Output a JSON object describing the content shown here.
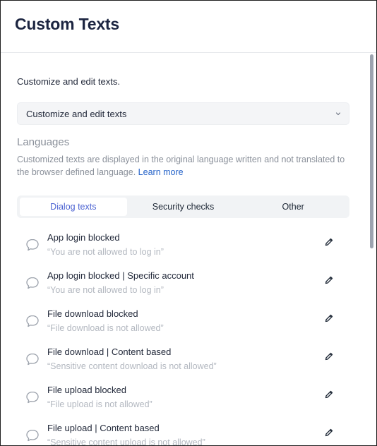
{
  "header": {
    "title": "Custom Texts"
  },
  "intro": "Customize and edit texts.",
  "select": {
    "value": "Customize and edit texts"
  },
  "languages": {
    "heading": "Languages",
    "description": "Customized texts are displayed in the original language written and not translated to the browser defined language.",
    "link": "Learn more"
  },
  "tabs": [
    {
      "label": "Dialog texts",
      "active": true
    },
    {
      "label": "Security checks",
      "active": false
    },
    {
      "label": "Other",
      "active": false
    }
  ],
  "items": [
    {
      "title": "App login blocked",
      "subtitle": "“You are not allowed to log in”"
    },
    {
      "title": "App login blocked | Specific account",
      "subtitle": "“You are not allowed to log in”"
    },
    {
      "title": "File download blocked",
      "subtitle": "“File download is not allowed”"
    },
    {
      "title": "File download | Content based",
      "subtitle": "“Sensitive content download is not allowed”"
    },
    {
      "title": "File upload blocked",
      "subtitle": "“File upload is not allowed”"
    },
    {
      "title": "File upload | Content based",
      "subtitle": "“Sensitive content upload is not allowed”"
    }
  ],
  "icons": {
    "item_icon": "speech-bubble-icon",
    "edit_icon": "pencil-icon",
    "select_icon": "chevron-down-icon"
  },
  "colors": {
    "title": "#1c2541",
    "active_tab": "#4c63d2",
    "link": "#2563c9",
    "muted": "#8a909a"
  }
}
